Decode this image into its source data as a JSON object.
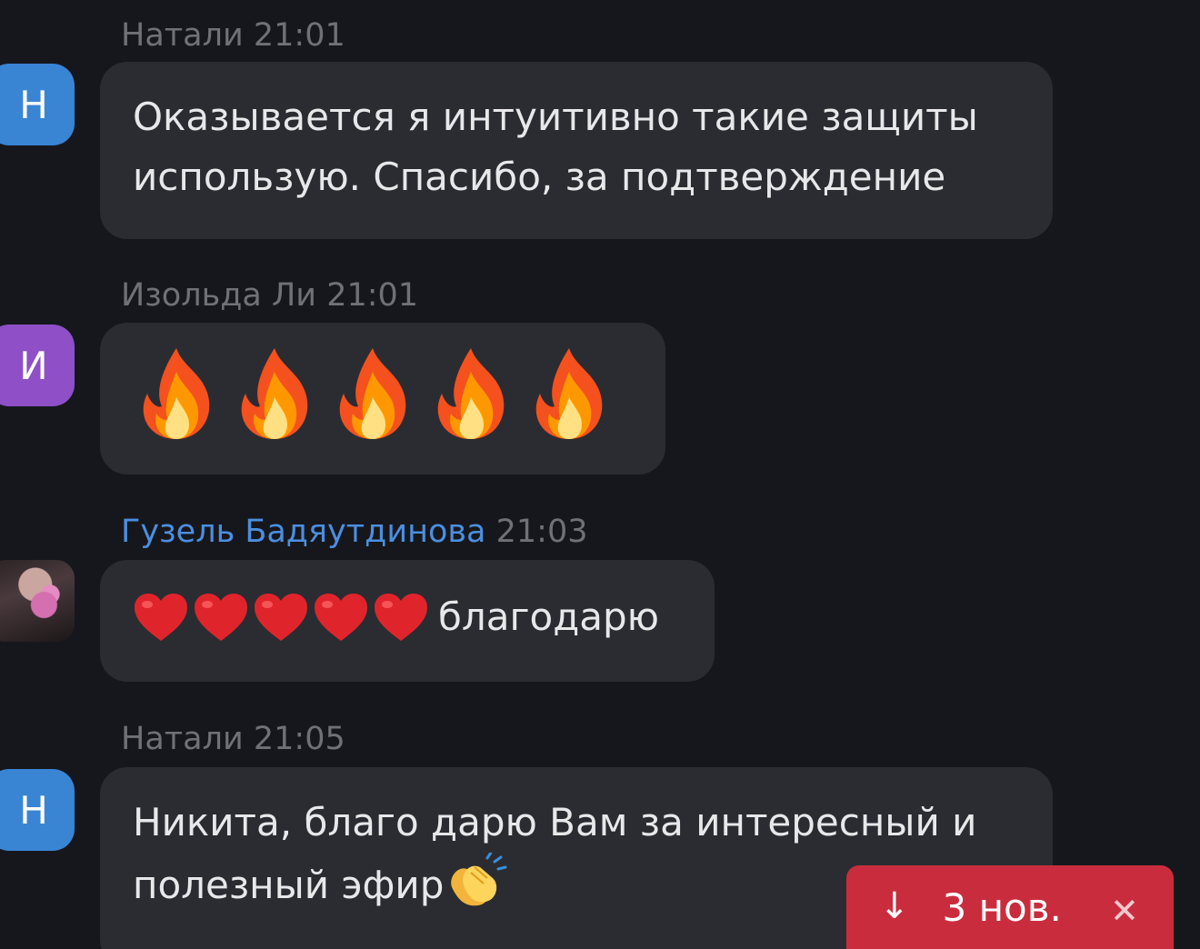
{
  "messages": [
    {
      "author": "Натали",
      "time": "21:01",
      "avatar_letter": "Н",
      "avatar_color": "#3a84d4",
      "lines": [
        "Оказывается я интуитивно такие защиты",
        "использую. Спасибо, за подтверждение"
      ]
    },
    {
      "author": "Изольда Ли",
      "time": "21:01",
      "avatar_letter": "И",
      "avatar_color": "#8e4fc7",
      "emoji": "fire",
      "emoji_count": 5
    },
    {
      "author": "Гузель Бадяутдинова",
      "time": "21:03",
      "avatar": "photo",
      "emoji": "heart",
      "emoji_count": 5,
      "text": "благодарю"
    },
    {
      "author": "Натали",
      "time": "21:05",
      "avatar_letter": "Н",
      "avatar_color": "#3a84d4",
      "line1": "Никита, благо дарю Вам за интересный и",
      "line2": "полезный эфир",
      "trailing_emoji": "clapping-hands"
    }
  ],
  "new_messages_badge": {
    "arrow": "↓",
    "label": "3 нов.",
    "close": "✕",
    "color": "#c92d3d"
  }
}
